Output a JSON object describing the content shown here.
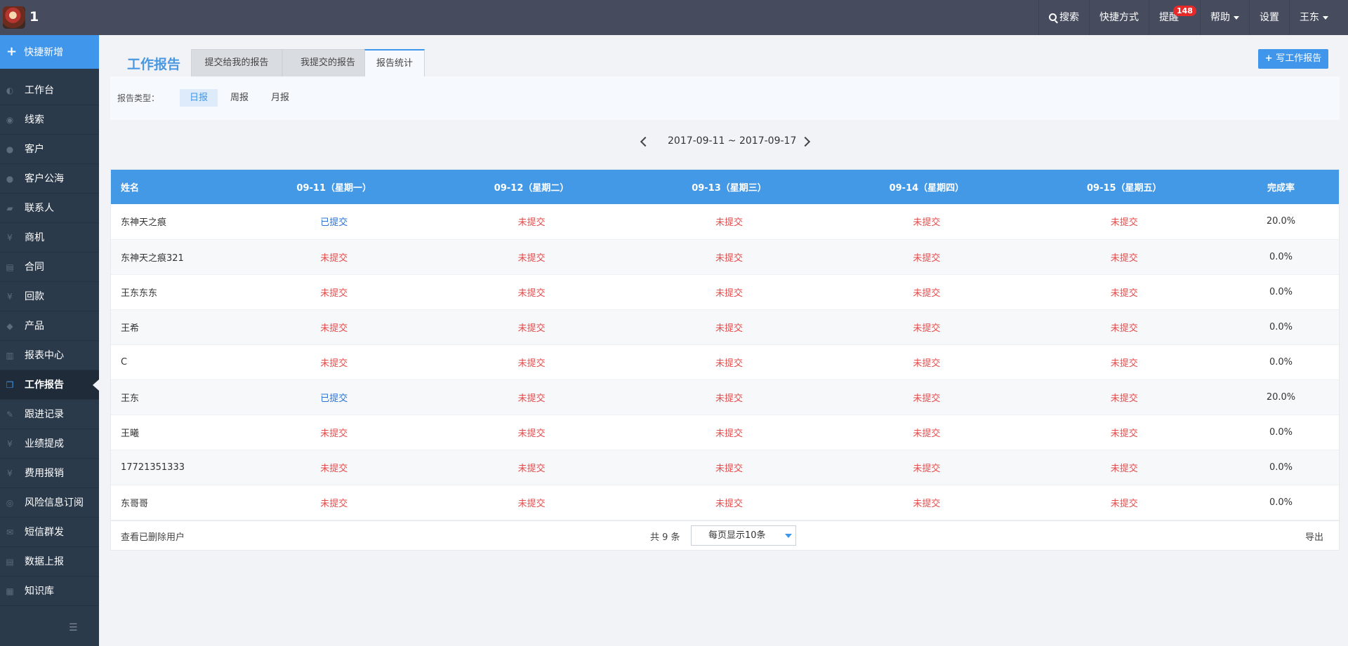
{
  "topbar": {
    "app_name": "1",
    "search": "搜索",
    "shortcuts": "快捷方式",
    "reminders": "提醒",
    "reminder_count": "148",
    "help": "帮助",
    "settings": "设置",
    "user": "王东"
  },
  "sidebar": {
    "quick_add": "快捷新增",
    "items": [
      {
        "label": "工作台",
        "icon": "dashboard-icon",
        "glyph": "◐"
      },
      {
        "label": "线索",
        "icon": "clue-icon",
        "glyph": "◉"
      },
      {
        "label": "客户",
        "icon": "customers-icon",
        "glyph": "●"
      },
      {
        "label": "客户公海",
        "icon": "customer-pool-icon",
        "glyph": "●"
      },
      {
        "label": "联系人",
        "icon": "contacts-icon",
        "glyph": "▰"
      },
      {
        "label": "商机",
        "icon": "opportunity-icon",
        "glyph": "¥"
      },
      {
        "label": "合同",
        "icon": "contract-icon",
        "glyph": "▤"
      },
      {
        "label": "回款",
        "icon": "payment-icon",
        "glyph": "¥"
      },
      {
        "label": "产品",
        "icon": "product-tag-icon",
        "glyph": "◆"
      },
      {
        "label": "报表中心",
        "icon": "report-chart-icon",
        "glyph": "▥"
      },
      {
        "label": "工作报告",
        "icon": "work-report-icon",
        "glyph": "❐"
      },
      {
        "label": "跟进记录",
        "icon": "follow-up-icon",
        "glyph": "✎"
      },
      {
        "label": "业绩提成",
        "icon": "commission-icon",
        "glyph": "¥"
      },
      {
        "label": "费用报销",
        "icon": "reimbursement-icon",
        "glyph": "¥"
      },
      {
        "label": "风险信息订阅",
        "icon": "risk-eye-icon",
        "glyph": "◎"
      },
      {
        "label": "短信群发",
        "icon": "sms-envelope-icon",
        "glyph": "✉"
      },
      {
        "label": "数据上报",
        "icon": "data-report-icon",
        "glyph": "▤"
      },
      {
        "label": "知识库",
        "icon": "knowledge-book-icon",
        "glyph": "▦"
      }
    ],
    "active_index": 10
  },
  "page": {
    "title": "工作报告",
    "tabs": [
      "提交给我的报告",
      "我提交的报告",
      "报告统计"
    ],
    "write_button": "写工作报告",
    "filter_label": "报告类型：",
    "filter_options": [
      "日报",
      "周报",
      "月报"
    ],
    "date_range": "2017-09-11 ~ 2017-09-17"
  },
  "table": {
    "headers": [
      "姓名",
      "09-11（星期一）",
      "09-12（星期二）",
      "09-13（星期三）",
      "09-14（星期四）",
      "09-15（星期五）",
      "完成率"
    ],
    "rows": [
      {
        "name": "东神天之痕",
        "days": [
          "已提交",
          "未提交",
          "未提交",
          "未提交",
          "未提交"
        ],
        "rate": "20.0%"
      },
      {
        "name": "东神天之痕321",
        "days": [
          "未提交",
          "未提交",
          "未提交",
          "未提交",
          "未提交"
        ],
        "rate": "0.0%"
      },
      {
        "name": "王东东东",
        "days": [
          "未提交",
          "未提交",
          "未提交",
          "未提交",
          "未提交"
        ],
        "rate": "0.0%"
      },
      {
        "name": "王希",
        "days": [
          "未提交",
          "未提交",
          "未提交",
          "未提交",
          "未提交"
        ],
        "rate": "0.0%"
      },
      {
        "name": "C",
        "days": [
          "未提交",
          "未提交",
          "未提交",
          "未提交",
          "未提交"
        ],
        "rate": "0.0%"
      },
      {
        "name": "王东",
        "days": [
          "已提交",
          "未提交",
          "未提交",
          "未提交",
          "未提交"
        ],
        "rate": "20.0%"
      },
      {
        "name": "王曦",
        "days": [
          "未提交",
          "未提交",
          "未提交",
          "未提交",
          "未提交"
        ],
        "rate": "0.0%"
      },
      {
        "name": "17721351333",
        "days": [
          "未提交",
          "未提交",
          "未提交",
          "未提交",
          "未提交"
        ],
        "rate": "0.0%"
      },
      {
        "name": "东哥哥",
        "days": [
          "未提交",
          "未提交",
          "未提交",
          "未提交",
          "未提交"
        ],
        "rate": "0.0%"
      }
    ],
    "status_submitted": "已提交"
  },
  "footer": {
    "view_deleted": "查看已删除用户",
    "total": "共 9 条",
    "page_size": "每页显示10条",
    "export": "导出"
  },
  "colors": {
    "accent": "#4096ea",
    "submitted": "#2a73d6",
    "not_submitted": "#e64b4b",
    "topbar": "#474b5e",
    "sidebar": "#2b3a4b"
  }
}
